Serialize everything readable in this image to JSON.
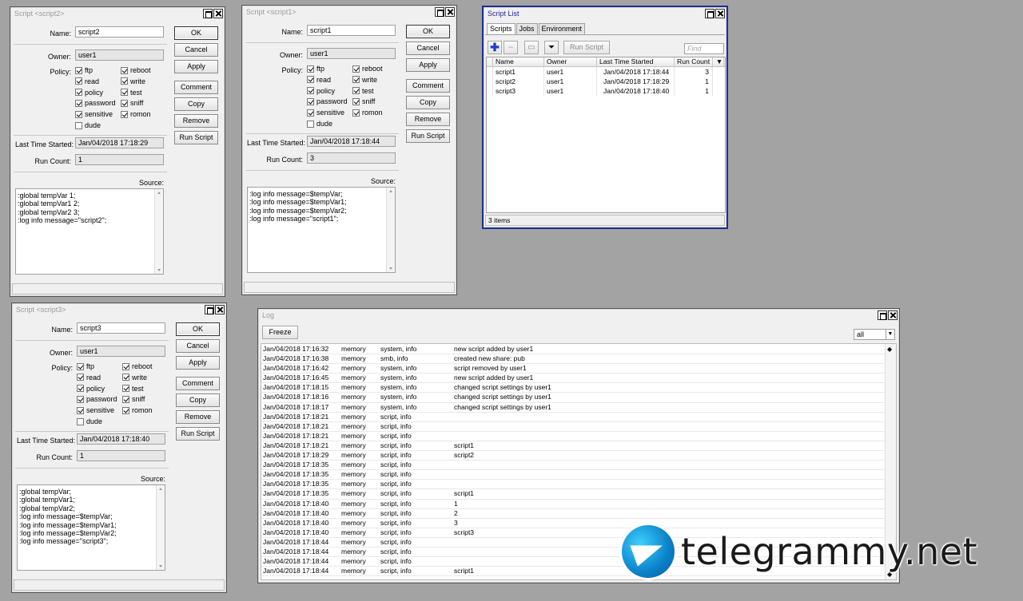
{
  "common": {
    "name_label": "Name:",
    "owner_label": "Owner:",
    "policy_label": "Policy:",
    "last_started_label": "Last Time Started:",
    "run_count_label": "Run Count:",
    "source_label": "Source:",
    "buttons": [
      "OK",
      "Cancel",
      "Apply",
      "Comment",
      "Copy",
      "Remove",
      "Run Script"
    ],
    "policies": [
      "ftp",
      "reboot",
      "read",
      "write",
      "policy",
      "test",
      "password",
      "sniff",
      "sensitive",
      "romon",
      "dude"
    ]
  },
  "script2": {
    "title": "Script <script2>",
    "name": "script2",
    "owner": "user1",
    "checked": [
      true,
      true,
      true,
      true,
      true,
      true,
      true,
      true,
      true,
      true,
      false
    ],
    "last_started": "Jan/04/2018 17:18:29",
    "run_count": "1",
    "source": ":global tempVar 1;\n:global tempVar1 2;\n:global tempVar2 3;\n:log info message=\"script2\";"
  },
  "script1": {
    "title": "Script <script1>",
    "name": "script1",
    "owner": "user1",
    "checked": [
      true,
      true,
      true,
      true,
      true,
      true,
      true,
      true,
      true,
      true,
      false
    ],
    "last_started": "Jan/04/2018 17:18:44",
    "run_count": "3",
    "source": ":log info message=$tempVar;\n:log info message=$tempVar1;\n:log info message=$tempVar2;\n:log info message=\"script1\";"
  },
  "script3": {
    "title": "Script <script3>",
    "name": "script3",
    "owner": "user1",
    "checked": [
      true,
      true,
      true,
      true,
      true,
      true,
      true,
      true,
      true,
      true,
      false
    ],
    "last_started": "Jan/04/2018 17:18:40",
    "run_count": "1",
    "source": ":global tempVar;\n:global tempVar1;\n:global tempVar2;\n:log info message=$tempVar;\n:log info message=$tempVar1;\n:log info message=$tempVar2;\n:log info message=\"script3\";"
  },
  "script_list": {
    "title": "Script List",
    "tabs": [
      "Scripts",
      "Jobs",
      "Environment"
    ],
    "run_script": "Run Script",
    "find_placeholder": "Find",
    "columns": [
      "Name",
      "Owner",
      "Last Time Started",
      "Run Count"
    ],
    "rows": [
      [
        "script1",
        "user1",
        "Jan/04/2018 17:18:44",
        "3"
      ],
      [
        "script2",
        "user1",
        "Jan/04/2018 17:18:29",
        "1"
      ],
      [
        "script3",
        "user1",
        "Jan/04/2018 17:18:40",
        "1"
      ]
    ],
    "status": "3 items"
  },
  "log": {
    "title": "Log",
    "freeze": "Freeze",
    "filter": "all",
    "rows": [
      [
        "Jan/04/2018 17:16:32",
        "memory",
        "system, info",
        "new script added by user1"
      ],
      [
        "Jan/04/2018 17:16:38",
        "memory",
        "smb, info",
        "created new share: pub"
      ],
      [
        "Jan/04/2018 17:16:42",
        "memory",
        "system, info",
        "script removed by user1"
      ],
      [
        "Jan/04/2018 17:16:45",
        "memory",
        "system, info",
        "new script added by user1"
      ],
      [
        "Jan/04/2018 17:18:15",
        "memory",
        "system, info",
        "changed script settings by user1"
      ],
      [
        "Jan/04/2018 17:18:16",
        "memory",
        "system, info",
        "changed script settings by user1"
      ],
      [
        "Jan/04/2018 17:18:17",
        "memory",
        "system, info",
        "changed script settings by user1"
      ],
      [
        "Jan/04/2018 17:18:21",
        "memory",
        "script, info",
        ""
      ],
      [
        "Jan/04/2018 17:18:21",
        "memory",
        "script, info",
        ""
      ],
      [
        "Jan/04/2018 17:18:21",
        "memory",
        "script, info",
        ""
      ],
      [
        "Jan/04/2018 17:18:21",
        "memory",
        "script, info",
        "script1"
      ],
      [
        "Jan/04/2018 17:18:29",
        "memory",
        "script, info",
        "script2"
      ],
      [
        "Jan/04/2018 17:18:35",
        "memory",
        "script, info",
        ""
      ],
      [
        "Jan/04/2018 17:18:35",
        "memory",
        "script, info",
        ""
      ],
      [
        "Jan/04/2018 17:18:35",
        "memory",
        "script, info",
        ""
      ],
      [
        "Jan/04/2018 17:18:35",
        "memory",
        "script, info",
        "script1"
      ],
      [
        "Jan/04/2018 17:18:40",
        "memory",
        "script, info",
        "1"
      ],
      [
        "Jan/04/2018 17:18:40",
        "memory",
        "script, info",
        "2"
      ],
      [
        "Jan/04/2018 17:18:40",
        "memory",
        "script, info",
        "3"
      ],
      [
        "Jan/04/2018 17:18:40",
        "memory",
        "script, info",
        "script3"
      ],
      [
        "Jan/04/2018 17:18:44",
        "memory",
        "script, info",
        ""
      ],
      [
        "Jan/04/2018 17:18:44",
        "memory",
        "script, info",
        ""
      ],
      [
        "Jan/04/2018 17:18:44",
        "memory",
        "script, info",
        ""
      ],
      [
        "Jan/04/2018 17:18:44",
        "memory",
        "script, info",
        "script1"
      ]
    ]
  },
  "watermark": {
    "text": "telegrammy.net"
  }
}
